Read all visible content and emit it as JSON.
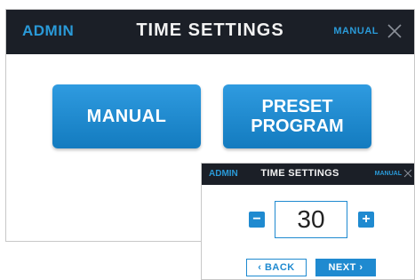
{
  "main": {
    "header": {
      "admin_label": "ADMIN",
      "title": "TIME SETTINGS",
      "mode_label": "MANUAL",
      "close_icon": "close-icon"
    },
    "buttons": {
      "manual_label": "MANUAL",
      "preset_line1": "PRESET",
      "preset_line2": "PROGRAM"
    }
  },
  "popup": {
    "header": {
      "admin_label": "ADMIN",
      "title": "TIME SETTINGS",
      "mode_label": "MANUAL",
      "close_icon": "close-icon"
    },
    "stepper": {
      "minus_label": "−",
      "value": "30",
      "plus_label": "+"
    },
    "nav": {
      "back_label": "‹ BACK",
      "next_label": "NEXT ›"
    }
  },
  "colors": {
    "header_bg": "#1b1f27",
    "accent_blue": "#2a9ad8",
    "button_blue": "#1f8ad0",
    "header_text": "#f2f2f2"
  }
}
